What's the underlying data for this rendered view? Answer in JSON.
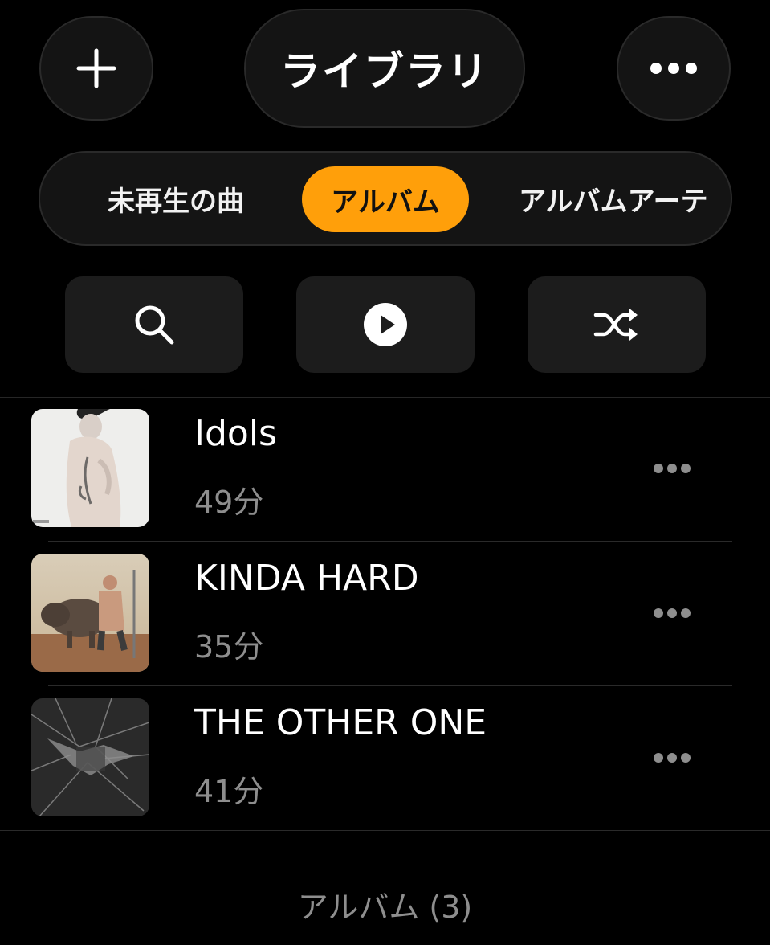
{
  "header": {
    "title": "ライブラリ",
    "add_icon": "plus-icon",
    "more_icon": "ellipsis-icon"
  },
  "tabs": [
    {
      "label": "未再生の曲",
      "selected": false
    },
    {
      "label": "アルバム",
      "selected": true
    },
    {
      "label": "アルバムアーテ",
      "selected": false
    }
  ],
  "actions": {
    "search_icon": "search-icon",
    "play_icon": "play-circle-icon",
    "shuffle_icon": "shuffle-icon"
  },
  "albums": [
    {
      "title": "Idols",
      "duration": "49分"
    },
    {
      "title": "KINDA HARD",
      "duration": "35分"
    },
    {
      "title": "THE OTHER ONE",
      "duration": "41分"
    }
  ],
  "footer": {
    "count_label": "アルバム (3)"
  },
  "colors": {
    "accent": "#ff9f0a",
    "background": "#000000",
    "secondary_text": "#8e8e8e"
  }
}
